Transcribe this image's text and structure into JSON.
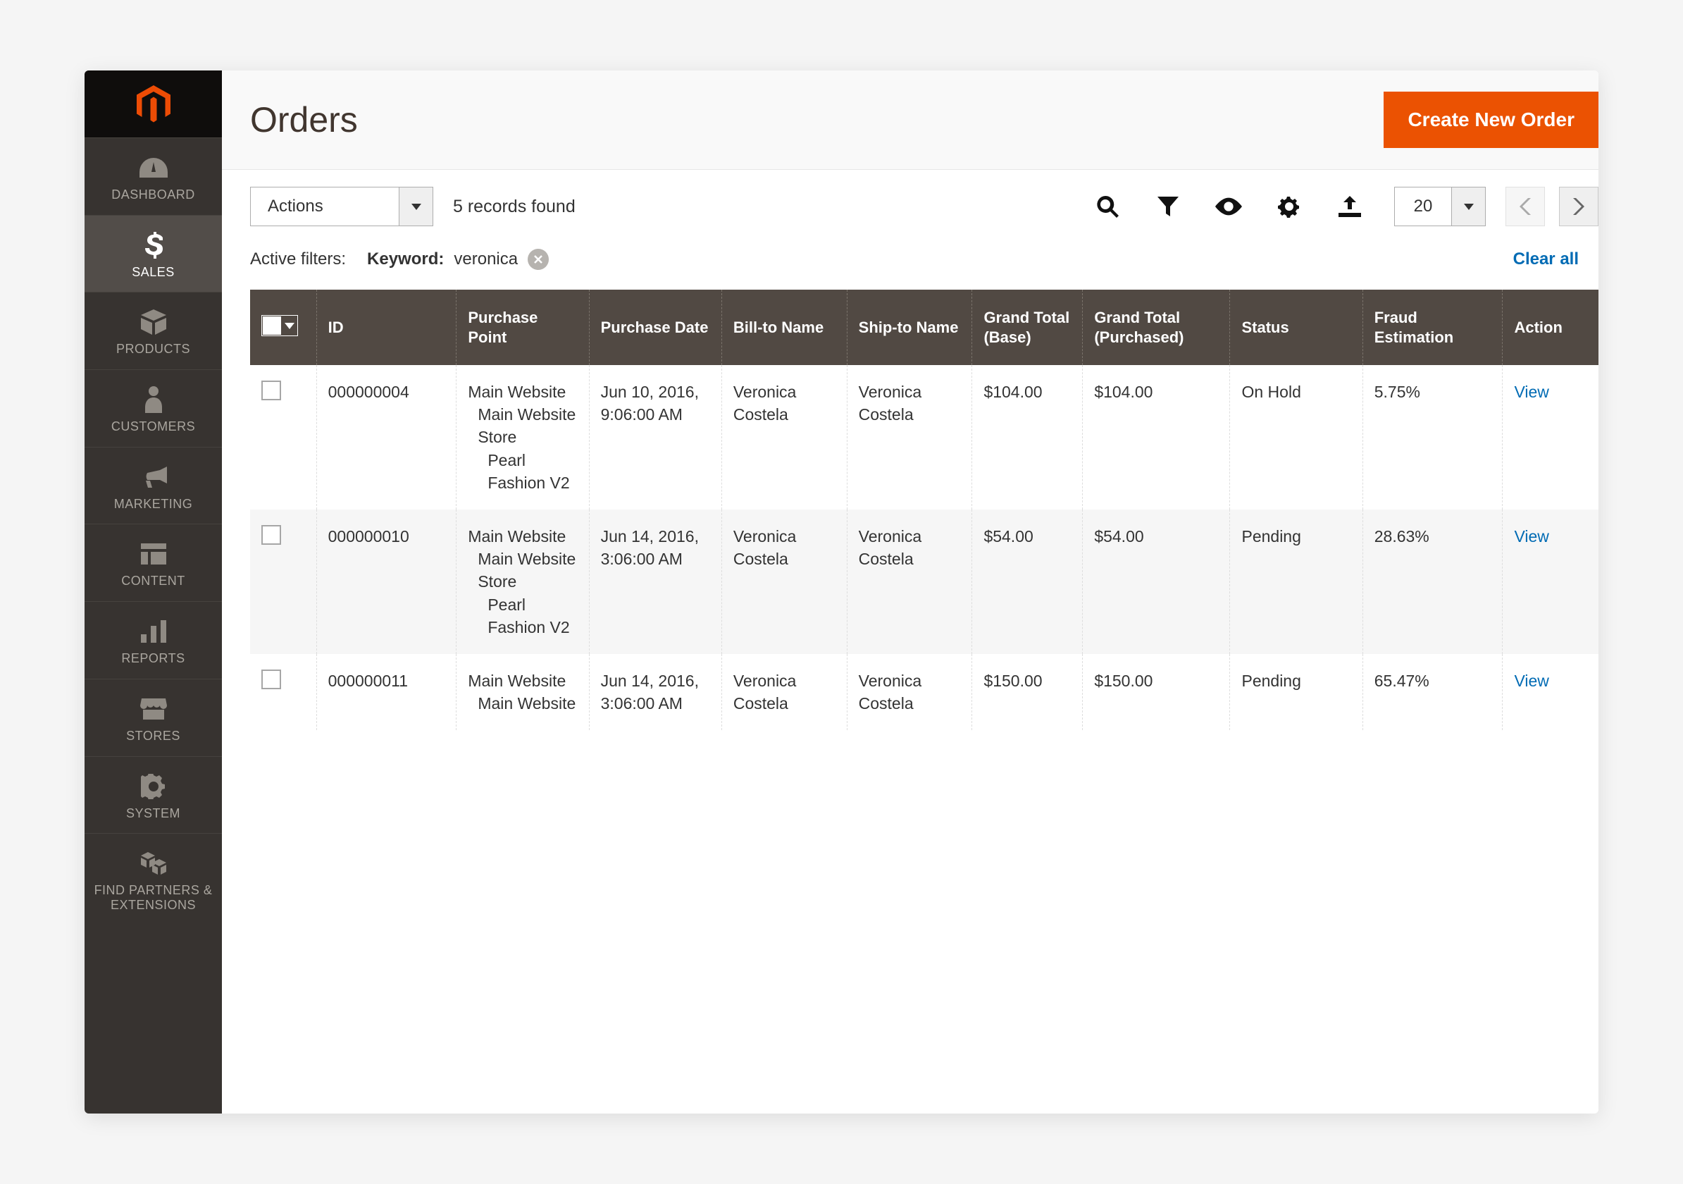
{
  "sidebar": {
    "items": [
      {
        "label": "DASHBOARD",
        "icon": "dashboard"
      },
      {
        "label": "SALES",
        "icon": "dollar",
        "active": true
      },
      {
        "label": "PRODUCTS",
        "icon": "products"
      },
      {
        "label": "CUSTOMERS",
        "icon": "customers"
      },
      {
        "label": "MARKETING",
        "icon": "marketing"
      },
      {
        "label": "CONTENT",
        "icon": "content"
      },
      {
        "label": "REPORTS",
        "icon": "reports"
      },
      {
        "label": "STORES",
        "icon": "stores"
      },
      {
        "label": "SYSTEM",
        "icon": "system"
      },
      {
        "label": "FIND PARTNERS & EXTENSIONS",
        "icon": "partners"
      }
    ]
  },
  "header": {
    "title": "Orders",
    "primary_button": "Create New Order"
  },
  "toolbar": {
    "actions_label": "Actions",
    "records_found": "5 records found",
    "page_size": "20"
  },
  "filters": {
    "label": "Active filters:",
    "chip_key": "Keyword:",
    "chip_value": "veronica",
    "clear_all": "Clear all"
  },
  "columns": {
    "id": "ID",
    "purchase_point": "Purchase Point",
    "purchase_date": "Purchase Date",
    "bill_to": "Bill-to Name",
    "ship_to": "Ship-to Name",
    "grand_total_base": "Grand Total (Base)",
    "grand_total_purchased": "Grand Total (Purchased)",
    "status": "Status",
    "fraud": "Fraud Estimation",
    "action": "Action"
  },
  "purchase_point_lines": {
    "l1": "Main Website",
    "l2": "Main Website Store",
    "l3": "Pearl Fashion V2",
    "l3_partial": "Main Website"
  },
  "rows": [
    {
      "id": "000000004",
      "date": "Jun 10, 2016, 9:06:00 AM",
      "bill_to": "Veronica Costela",
      "ship_to": "Veronica Costela",
      "gt_base": "$104.00",
      "gt_purchased": "$104.00",
      "status": "On Hold",
      "fraud": "5.75%",
      "action": "View"
    },
    {
      "id": "000000010",
      "date": "Jun 14, 2016, 3:06:00 AM",
      "bill_to": "Veronica Costela",
      "ship_to": "Veronica Costela",
      "gt_base": "$54.00",
      "gt_purchased": "$54.00",
      "status": "Pending",
      "fraud": "28.63%",
      "action": "View"
    },
    {
      "id": "000000011",
      "date": "Jun 14, 2016, 3:06:00 AM",
      "bill_to": "Veronica Costela",
      "ship_to": "Veronica Costela",
      "gt_base": "$150.00",
      "gt_purchased": "$150.00",
      "status": "Pending",
      "fraud": "65.47%",
      "action": "View"
    }
  ]
}
